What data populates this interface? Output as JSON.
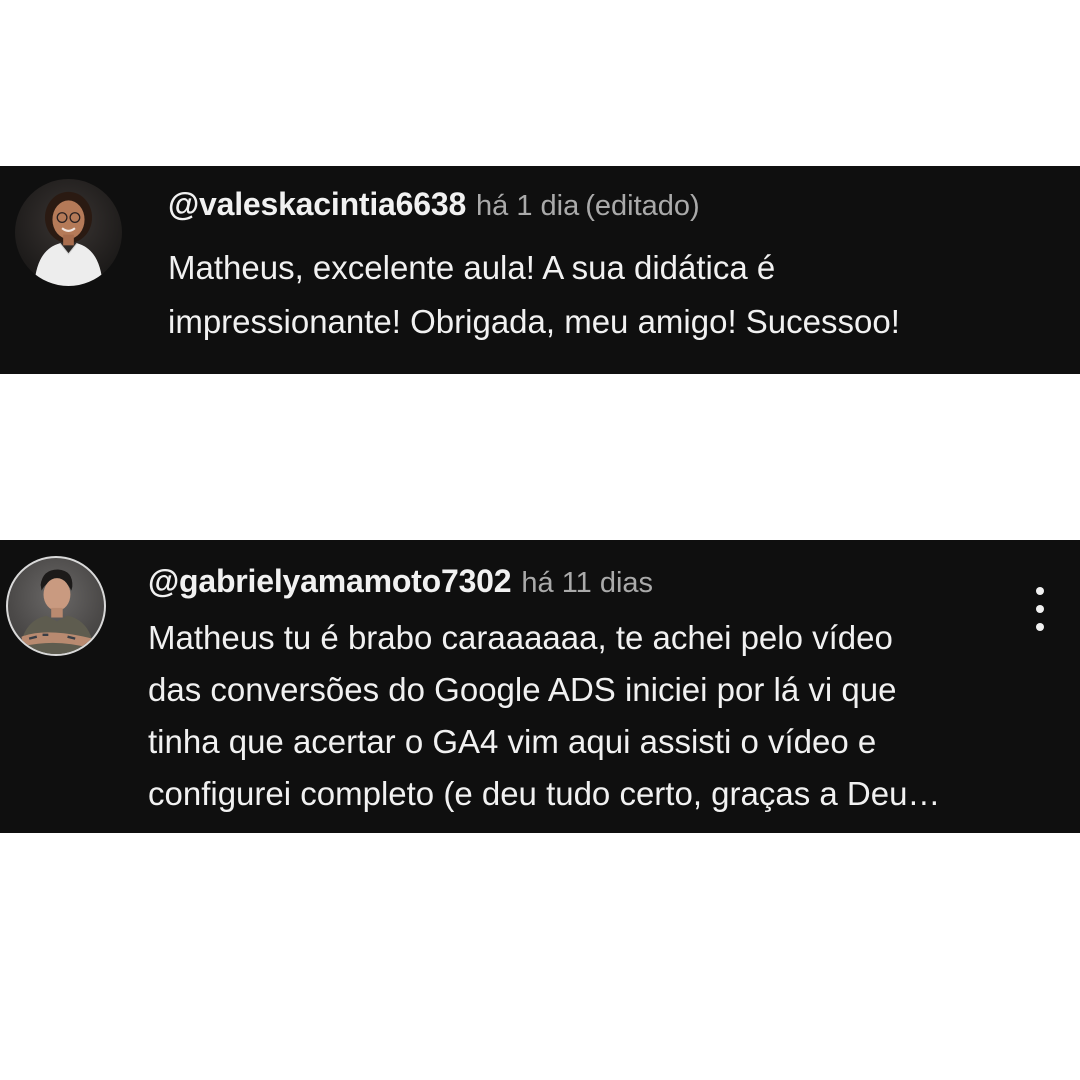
{
  "comments": [
    {
      "handle": "@valeskacintia6638",
      "time": "há 1 dia",
      "edited": "(editado)",
      "text": "Matheus, excelente aula! A sua didática é\nimpressionante! Obrigada, meu amigo! Sucessoo!",
      "avatar_icon": "user-avatar-woman"
    },
    {
      "handle": "@gabrielyamamoto7302",
      "time": "há 11 dias",
      "text": "Matheus tu é brabo caraaaaaa, te achei pelo vídeo\ndas conversões do Google ADS iniciei por lá vi que\ntinha que acertar o GA4 vim aqui assisti o vídeo e\nconfigurei completo (e deu tudo certo, graças a Deu…",
      "avatar_icon": "user-avatar-man",
      "menu_icon": "more-vertical-icon"
    }
  ],
  "colors": {
    "background": "#ffffff",
    "comment_bg": "#0f0f0f",
    "text_primary": "#f1f1f1",
    "text_secondary": "#aaaaaa"
  }
}
